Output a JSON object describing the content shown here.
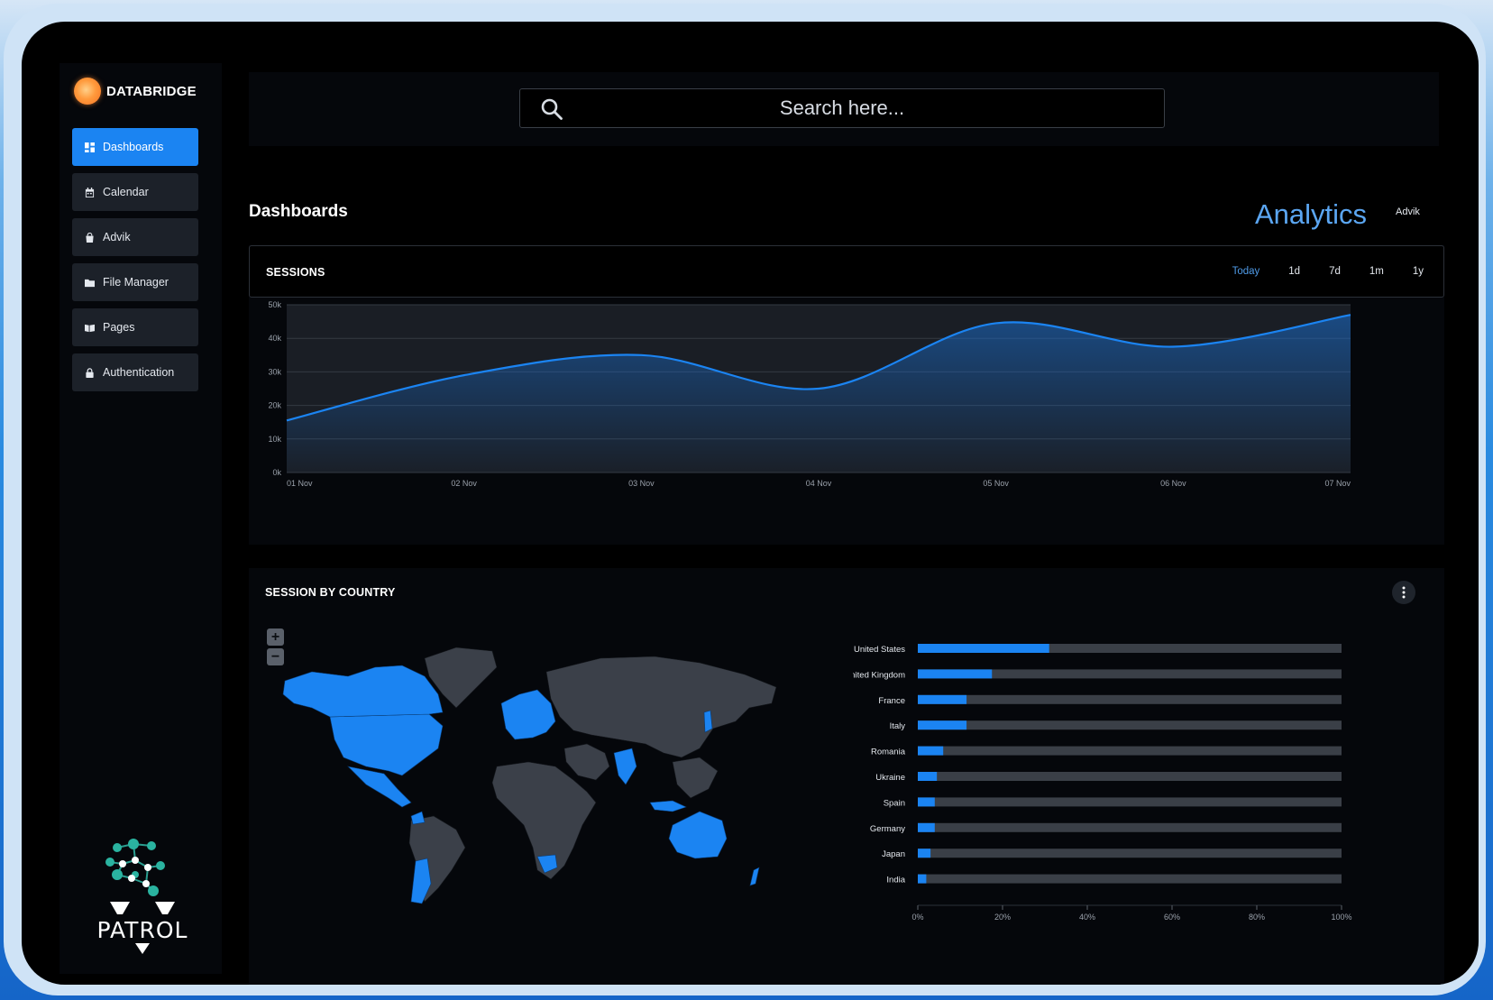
{
  "brand": {
    "name": "DATABRIDGE"
  },
  "sidebar": {
    "items": [
      {
        "label": "Dashboards",
        "icon": "dashboard-icon",
        "active": true
      },
      {
        "label": "Calendar",
        "icon": "calendar-icon",
        "active": false
      },
      {
        "label": "Advik",
        "icon": "bag-icon",
        "active": false
      },
      {
        "label": "File Manager",
        "icon": "folder-icon",
        "active": false
      },
      {
        "label": "Pages",
        "icon": "pages-icon",
        "active": false
      },
      {
        "label": "Authentication",
        "icon": "lock-icon",
        "active": false
      }
    ],
    "footer_logo": {
      "text": "PATROL"
    }
  },
  "search": {
    "placeholder": "Search here...",
    "value": ""
  },
  "header": {
    "page_title": "Dashboards",
    "section_title": "Analytics",
    "user_link": "Advik"
  },
  "sessions": {
    "title": "SESSIONS",
    "ranges": [
      "Today",
      "1d",
      "7d",
      "1m",
      "1y"
    ],
    "active_range": "Today"
  },
  "country": {
    "title": "SESSION BY COUNTRY",
    "zoom_in": "+",
    "zoom_out": "−"
  },
  "colors": {
    "accent": "#1b84f2",
    "highlight_text": "#5ba6f2",
    "track": "#3a3f47",
    "map_land": "#3b4049"
  },
  "chart_data": [
    {
      "type": "area",
      "title": "SESSIONS",
      "x": [
        "01 Nov",
        "02 Nov",
        "03 Nov",
        "04 Nov",
        "05 Nov",
        "06 Nov",
        "07 Nov"
      ],
      "y_ticks": [
        "0k",
        "10k",
        "20k",
        "30k",
        "40k",
        "50k"
      ],
      "ylim": [
        0,
        50000
      ],
      "series": [
        {
          "values": [
            15500,
            29000,
            35000,
            25000,
            44500,
            37500,
            47000
          ]
        }
      ],
      "grid": true
    },
    {
      "type": "bar",
      "orientation": "horizontal",
      "title": "SESSION BY COUNTRY",
      "categories": [
        "United States",
        "United Kingdom",
        "France",
        "Italy",
        "Romania",
        "Ukraine",
        "Spain",
        "Germany",
        "Japan",
        "India"
      ],
      "values": [
        31,
        17.5,
        11.5,
        11.5,
        6,
        4.5,
        4,
        4,
        3,
        2
      ],
      "x_ticks": [
        "0%",
        "20%",
        "40%",
        "60%",
        "80%",
        "100%"
      ],
      "xlim": [
        0,
        100
      ]
    }
  ]
}
